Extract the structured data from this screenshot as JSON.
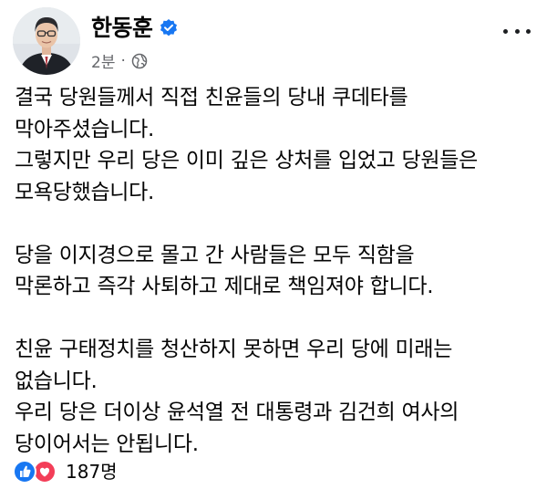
{
  "post": {
    "author": {
      "name": "한동훈",
      "verified": true,
      "verified_icon": "verified-badge-icon",
      "avatar_icon": "profile-photo"
    },
    "meta": {
      "time": "2분",
      "separator": "·",
      "privacy_icon": "globe-icon"
    },
    "menu_icon": "more-options-icon",
    "body_lines": [
      "결국 당원들께서 직접 친윤들의 당내 쿠데타를",
      "막아주셨습니다.",
      "그렇지만 우리 당은 이미 깊은 상처를 입었고 당원들은",
      "모욕당했습니다.",
      "",
      "당을 이지경으로 몰고 간 사람들은 모두 직함을",
      "막론하고 즉각 사퇴하고 제대로 책임져야 합니다.",
      "",
      "친윤 구태정치를 청산하지 못하면 우리 당에 미래는",
      "없습니다.",
      "우리 당은 더이상 윤석열 전 대통령과 김건희 여사의",
      "당이어서는 안됩니다."
    ],
    "reactions": {
      "icons": [
        "like-icon",
        "love-icon"
      ],
      "count": "187명"
    },
    "colors": {
      "text": "#050505",
      "secondary": "#65676b",
      "verified": "#1877f2",
      "like": "#1877f2",
      "love": "#f33e58"
    }
  }
}
